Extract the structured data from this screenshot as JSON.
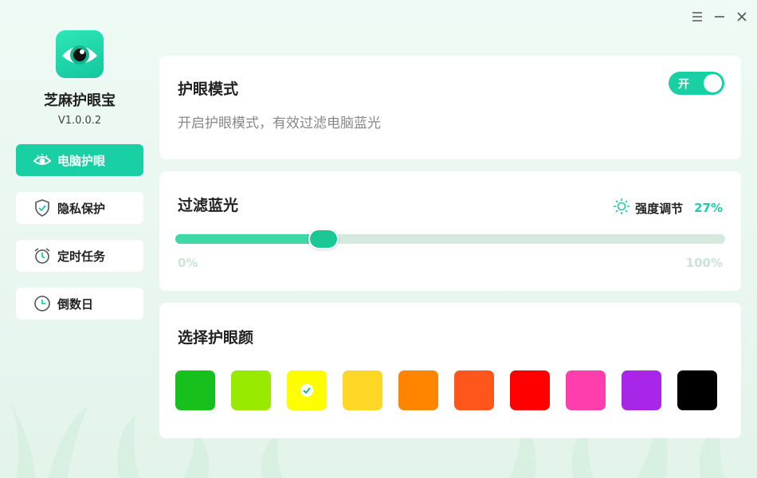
{
  "app": {
    "name": "芝麻护眼宝",
    "version": "V1.0.0.2"
  },
  "window_controls": [
    "menu-icon",
    "minimize-icon",
    "close-icon"
  ],
  "nav": [
    {
      "label": "电脑护眼",
      "icon": "eye-icon",
      "active": true
    },
    {
      "label": "隐私保护",
      "icon": "shield-check-icon",
      "active": false
    },
    {
      "label": "定时任务",
      "icon": "alarm-clock-icon",
      "active": false
    },
    {
      "label": "倒数日",
      "icon": "clock-icon",
      "active": false
    }
  ],
  "eye_mode": {
    "title": "护眼模式",
    "description": "开启护眼模式，有效过滤电脑蓝光",
    "toggle_label": "开",
    "enabled": true
  },
  "blue_light": {
    "title": "过滤蓝光",
    "strength_label": "强度调节",
    "strength_value": "27%",
    "strength_fraction": 0.27,
    "min_label": "0%",
    "max_label": "100%"
  },
  "colors": {
    "title": "选择护眼颜",
    "options": [
      "#17c01c",
      "#97ea00",
      "#fefe00",
      "#ffd727",
      "#ff8500",
      "#ff561b",
      "#ff0000",
      "#ff3eae",
      "#a826e8",
      "#000000"
    ],
    "selected_index": 2
  },
  "accent": "#19cfa4"
}
